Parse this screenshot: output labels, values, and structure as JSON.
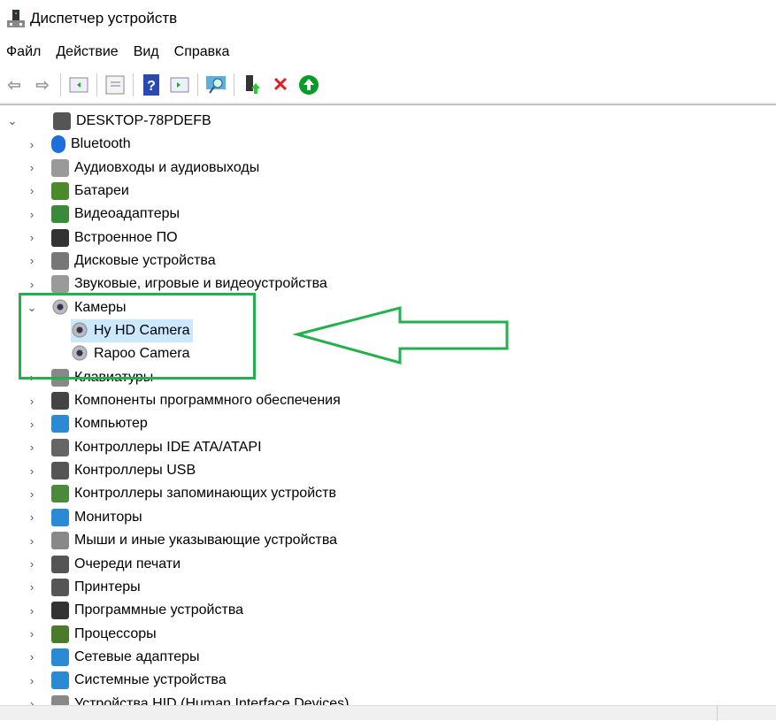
{
  "window": {
    "title": "Диспетчер устройств"
  },
  "menu": [
    "Файл",
    "Действие",
    "Вид",
    "Справка"
  ],
  "toolbar": [
    "back",
    "forward",
    "show-hide-console-tree",
    "properties",
    "help",
    "show-action-pane",
    "scan-hardware",
    "update-driver",
    "uninstall-device",
    "enable-device"
  ],
  "tree": {
    "root": "DESKTOP-78PDEFB",
    "categories": [
      {
        "label": "Bluetooth",
        "icon": "bluetooth-icon",
        "color": "#1e6fd9"
      },
      {
        "label": "Аудиовходы и аудиовыходы",
        "icon": "speaker-icon",
        "color": "#9a9a9a"
      },
      {
        "label": "Батареи",
        "icon": "battery-icon",
        "color": "#4a8a2a"
      },
      {
        "label": "Видеоадаптеры",
        "icon": "display-adapter-icon",
        "color": "#3a8a3a"
      },
      {
        "label": "Встроенное ПО",
        "icon": "firmware-icon",
        "color": "#333"
      },
      {
        "label": "Дисковые устройства",
        "icon": "disk-icon",
        "color": "#777"
      },
      {
        "label": "Звуковые, игровые и видеоустройства",
        "icon": "sound-icon",
        "color": "#9a9a9a"
      },
      {
        "label": "Камеры",
        "icon": "camera-icon",
        "color": "#8a8a8a",
        "expanded": true,
        "children": [
          {
            "label": "Hy HD Camera",
            "icon": "camera-download-icon",
            "selected": true
          },
          {
            "label": "Rapoo Camera",
            "icon": "camera-icon"
          }
        ]
      },
      {
        "label": "Клавиатуры",
        "icon": "keyboard-icon",
        "color": "#888"
      },
      {
        "label": "Компоненты программного обеспечения",
        "icon": "software-component-icon",
        "color": "#444"
      },
      {
        "label": "Компьютер",
        "icon": "computer-icon",
        "color": "#2a8ad4"
      },
      {
        "label": "Контроллеры IDE ATA/ATAPI",
        "icon": "ide-icon",
        "color": "#666"
      },
      {
        "label": "Контроллеры USB",
        "icon": "usb-icon",
        "color": "#555"
      },
      {
        "label": "Контроллеры запоминающих устройств",
        "icon": "storage-controller-icon",
        "color": "#4a8a3a"
      },
      {
        "label": "Мониторы",
        "icon": "monitor-icon",
        "color": "#2a8ad4"
      },
      {
        "label": "Мыши и иные указывающие устройства",
        "icon": "mouse-icon",
        "color": "#888"
      },
      {
        "label": "Очереди печати",
        "icon": "print-queue-icon",
        "color": "#555"
      },
      {
        "label": "Принтеры",
        "icon": "printer-icon",
        "color": "#555"
      },
      {
        "label": "Программные устройства",
        "icon": "software-device-icon",
        "color": "#333"
      },
      {
        "label": "Процессоры",
        "icon": "processor-icon",
        "color": "#4a7a2a"
      },
      {
        "label": "Сетевые адаптеры",
        "icon": "network-adapter-icon",
        "color": "#2a8ad4"
      },
      {
        "label": "Системные устройства",
        "icon": "system-device-icon",
        "color": "#2a8ad4"
      },
      {
        "label": "Устройства HID (Human Interface Devices)",
        "icon": "hid-icon",
        "color": "#888"
      }
    ]
  },
  "annotation": {
    "color": "#22b14c"
  }
}
